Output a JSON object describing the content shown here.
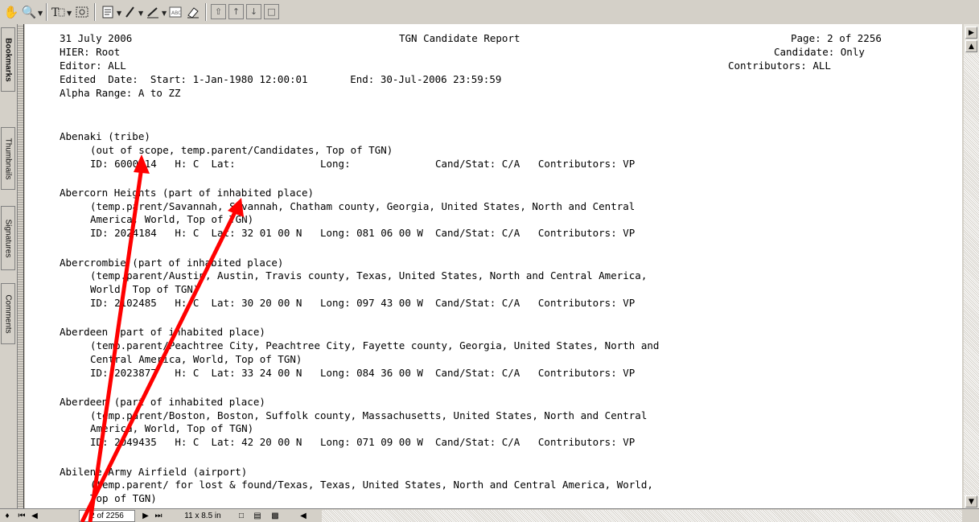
{
  "toolbar": {
    "tools": [
      "hand-tool",
      "zoom-tool",
      "text-select-tool",
      "snapshot-tool",
      "note-tool",
      "pencil-tool",
      "markup-tool",
      "stamp-tool",
      "eraser-tool",
      "first-page",
      "prev-page",
      "next-page",
      "last-page"
    ]
  },
  "nav_tabs": [
    "Bookmarks",
    "Thumbnails",
    "Signatures",
    "Comments"
  ],
  "report": {
    "date": "31 July 2006",
    "title": "TGN Candidate Report",
    "page": "Page: 2 of 2256",
    "hier": "HIER: Root",
    "candidate": "Candidate: Only",
    "editor": "Editor: ALL",
    "contributors": "Contributors: ALL",
    "edited_date": "Edited  Date:  Start: 1-Jan-1980 12:00:01       End: 30-Jul-2006 23:59:59",
    "alpha_range": "Alpha Range: A to ZZ"
  },
  "entries": [
    {
      "name": "Abenaki (tribe)",
      "lines": [
        "(out of scope, temp.parent/Candidates, Top of TGN)",
        "ID: 6000014   H: C  Lat:              Long:              Cand/Stat: C/A   Contributors: VP"
      ]
    },
    {
      "name": "Abercorn Heights (part of inhabited place)",
      "lines": [
        "(temp.parent/Savannah, Savannah, Chatham county, Georgia, United States, North and Central",
        "America, World, Top of TGN)",
        "ID: 2024184   H: C  Lat: 32 01 00 N   Long: 081 06 00 W  Cand/Stat: C/A   Contributors: VP"
      ]
    },
    {
      "name": "Abercrombie (part of inhabited place)",
      "lines": [
        "(temp.parent/Austin, Austin, Travis county, Texas, United States, North and Central America,",
        "World, Top of TGN)",
        "ID: 2102485   H: C  Lat: 30 20 00 N   Long: 097 43 00 W  Cand/Stat: C/A   Contributors: VP"
      ]
    },
    {
      "name": "Aberdeen (part of inhabited place)",
      "lines": [
        "(temp.parent/Peachtree City, Peachtree City, Fayette county, Georgia, United States, North and",
        "Central America, World, Top of TGN)",
        "ID: 2023877   H: C  Lat: 33 24 00 N   Long: 084 36 00 W  Cand/Stat: C/A   Contributors: VP"
      ]
    },
    {
      "name": "Aberdeen (part of inhabited place)",
      "lines": [
        "(temp.parent/Boston, Boston, Suffolk county, Massachusetts, United States, North and Central",
        "America, World, Top of TGN)",
        "ID: 2049435   H: C  Lat: 42 20 00 N   Long: 071 09 00 W  Cand/Stat: C/A   Contributors: VP"
      ]
    },
    {
      "name": "Abilene Army Airfield (airport)",
      "lines": [
        "(temp.parent/ for lost & found/Texas, Texas, United States, North and Central America, World,",
        "Top of TGN)"
      ]
    }
  ],
  "statusbar": {
    "page_field": "2 of 2256",
    "page_size": "11 x 8.5 in"
  },
  "colors": {
    "arrow": "#ff0000",
    "chrome": "#d4d0c8",
    "page": "#ffffff"
  }
}
